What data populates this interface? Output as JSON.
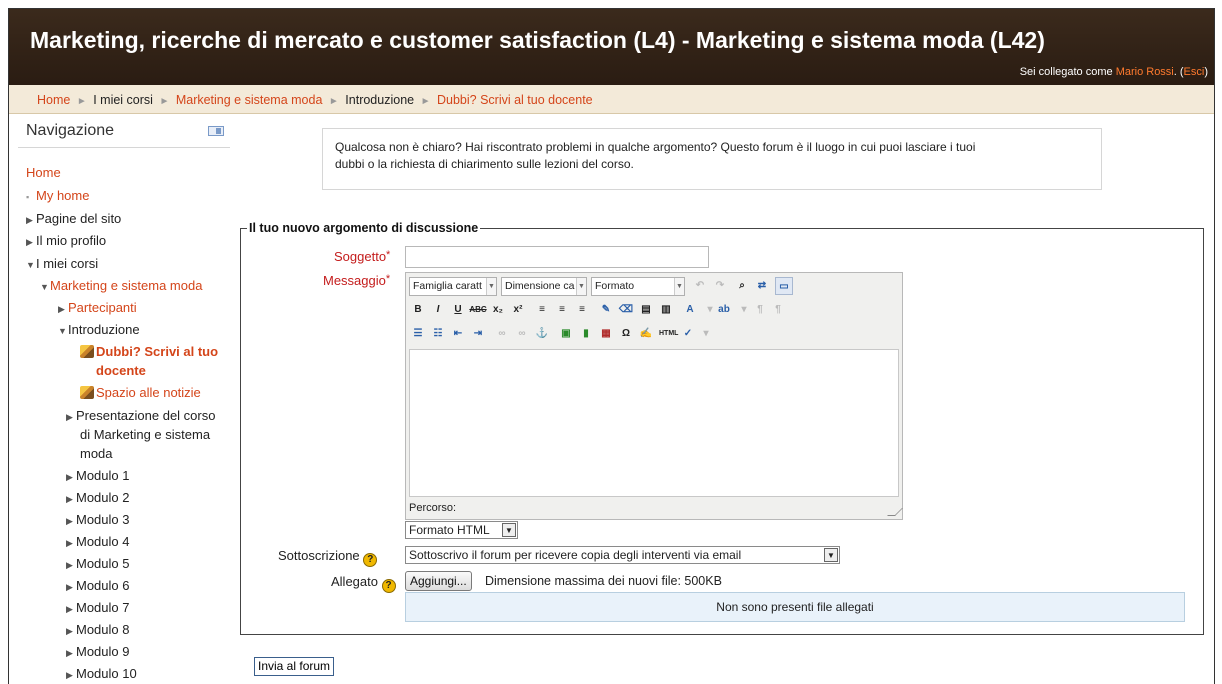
{
  "header": {
    "title": "Marketing, ricerche di mercato e customer satisfaction (L4) - Marketing e sistema moda (L42)",
    "login_prefix": "Sei collegato come ",
    "login_user": "Mario Rossi",
    "login_open": ". (",
    "logout": "Esci",
    "login_close": ")"
  },
  "breadcrumb": {
    "home": "Home",
    "my_courses": "I miei corsi",
    "course": "Marketing e sistema moda",
    "section": "Introduzione",
    "current": "Dubbi? Scrivi al tuo docente",
    "sep": "►"
  },
  "nav": {
    "title": "Navigazione",
    "items": {
      "home": "Home",
      "my_home": "My home",
      "site_pages": "Pagine del sito",
      "my_profile": "Il mio profilo",
      "my_courses": "I miei corsi",
      "course": "Marketing e sistema moda",
      "participants": "Partecipanti",
      "intro": "Introduzione",
      "forum1_a": "Dubbi? Scrivi al tuo",
      "forum1_b": "docente",
      "forum2": "Spazio alle notizie",
      "presentation_a": "Presentazione del corso",
      "presentation_b": "di Marketing e sistema",
      "presentation_c": "moda",
      "m1": "Modulo 1",
      "m2": "Modulo 2",
      "m3": "Modulo 3",
      "m4": "Modulo 4",
      "m5": "Modulo 5",
      "m6": "Modulo 6",
      "m7": "Modulo 7",
      "m8": "Modulo 8",
      "m9": "Modulo 9",
      "m10": "Modulo 10"
    }
  },
  "intro": {
    "line1": "Qualcosa non è chiaro? Hai riscontrato problemi in qualche argomento? Questo forum è il luogo in cui puoi lasciare i tuoi",
    "line2": "dubbi o la richiesta di chiarimento sulle lezioni del corso."
  },
  "form": {
    "legend": "Il tuo nuovo argomento di discussione",
    "subject_label": "Soggetto",
    "subject_value": "",
    "message_label": "Messaggio",
    "required_mark": "*",
    "editor": {
      "font_family": "Famiglia caratt",
      "font_size": "Dimensione ca",
      "format": "Formato",
      "path_label": "Percorso:"
    },
    "format_select": "Formato HTML",
    "subscription_label": "Sottoscrizione",
    "subscription_value": "Sottoscrivo il forum per ricevere copia degli interventi via email",
    "attachment_label": "Allegato",
    "add_button": "Aggiungi...",
    "max_size": "Dimensione massima dei nuovi file: 500KB",
    "no_files": "Non sono presenti file allegati",
    "help": "?",
    "submit": "Invia al forum"
  },
  "colors": {
    "header_bg": "#2f2116",
    "link": "#d4451a",
    "breadcrumb_bg": "#f3ead9",
    "required": "#c41c1c"
  }
}
